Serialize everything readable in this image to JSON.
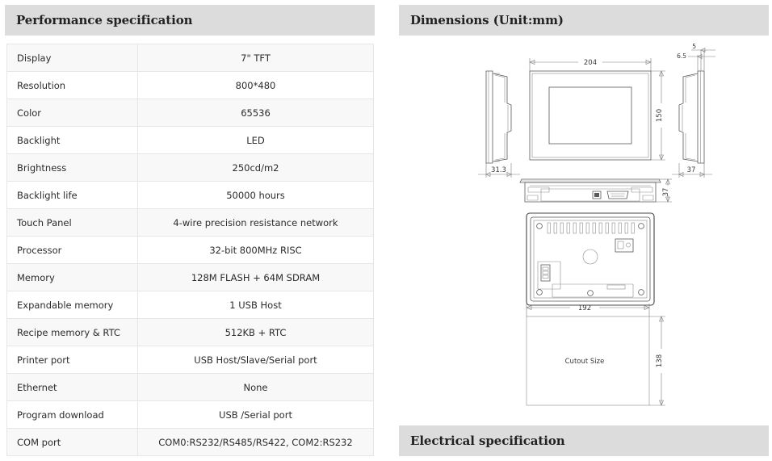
{
  "left_panel": {
    "header_title": "Performance specification",
    "table": {
      "rows": [
        {
          "label": "Display",
          "value": "7\" TFT"
        },
        {
          "label": "Resolution",
          "value": "800*480"
        },
        {
          "label": "Color",
          "value": "65536"
        },
        {
          "label": "Backlight",
          "value": "LED"
        },
        {
          "label": "Brightness",
          "value": "250cd/m2"
        },
        {
          "label": "Backlight life",
          "value": "50000 hours"
        },
        {
          "label": "Touch Panel",
          "value": "4-wire precision resistance network"
        },
        {
          "label": "Processor",
          "value": "32-bit 800MHz RISC"
        },
        {
          "label": "Memory",
          "value": "128M FLASH + 64M SDRAM"
        },
        {
          "label": "Expandable memory",
          "value": "1 USB Host"
        },
        {
          "label": "Recipe memory & RTC",
          "value": "512KB + RTC"
        },
        {
          "label": "Printer port",
          "value": "USB Host/Slave/Serial port"
        },
        {
          "label": "Ethernet",
          "value": "None"
        },
        {
          "label": "Program download",
          "value": "USB /Serial port"
        },
        {
          "label": "COM port",
          "value": "COM0:RS232/RS485/RS422, COM2:RS232"
        }
      ]
    }
  },
  "right_panel": {
    "dimensions_header_title": "Dimensions (Unit:mm)",
    "electrical_header_title": "Electrical specification",
    "drawing_labels": {
      "side_left_depth": "31.3",
      "front_width": "204",
      "front_height": "150",
      "side_right_bezel_top": "5",
      "side_right_bezel_second": "6.5",
      "side_right_depth": "37",
      "bottom_view_height": "37",
      "cutout_width": "192",
      "cutout_height": "138",
      "cutout_caption": "Cutout Size"
    }
  },
  "theme": {
    "header_bg": "#dcdcdc",
    "header_text": "#222222",
    "table_border": "#e6e6e6",
    "row_alt_bg": "#f8f8f8",
    "drawing_stroke": "#5a5a5a"
  }
}
